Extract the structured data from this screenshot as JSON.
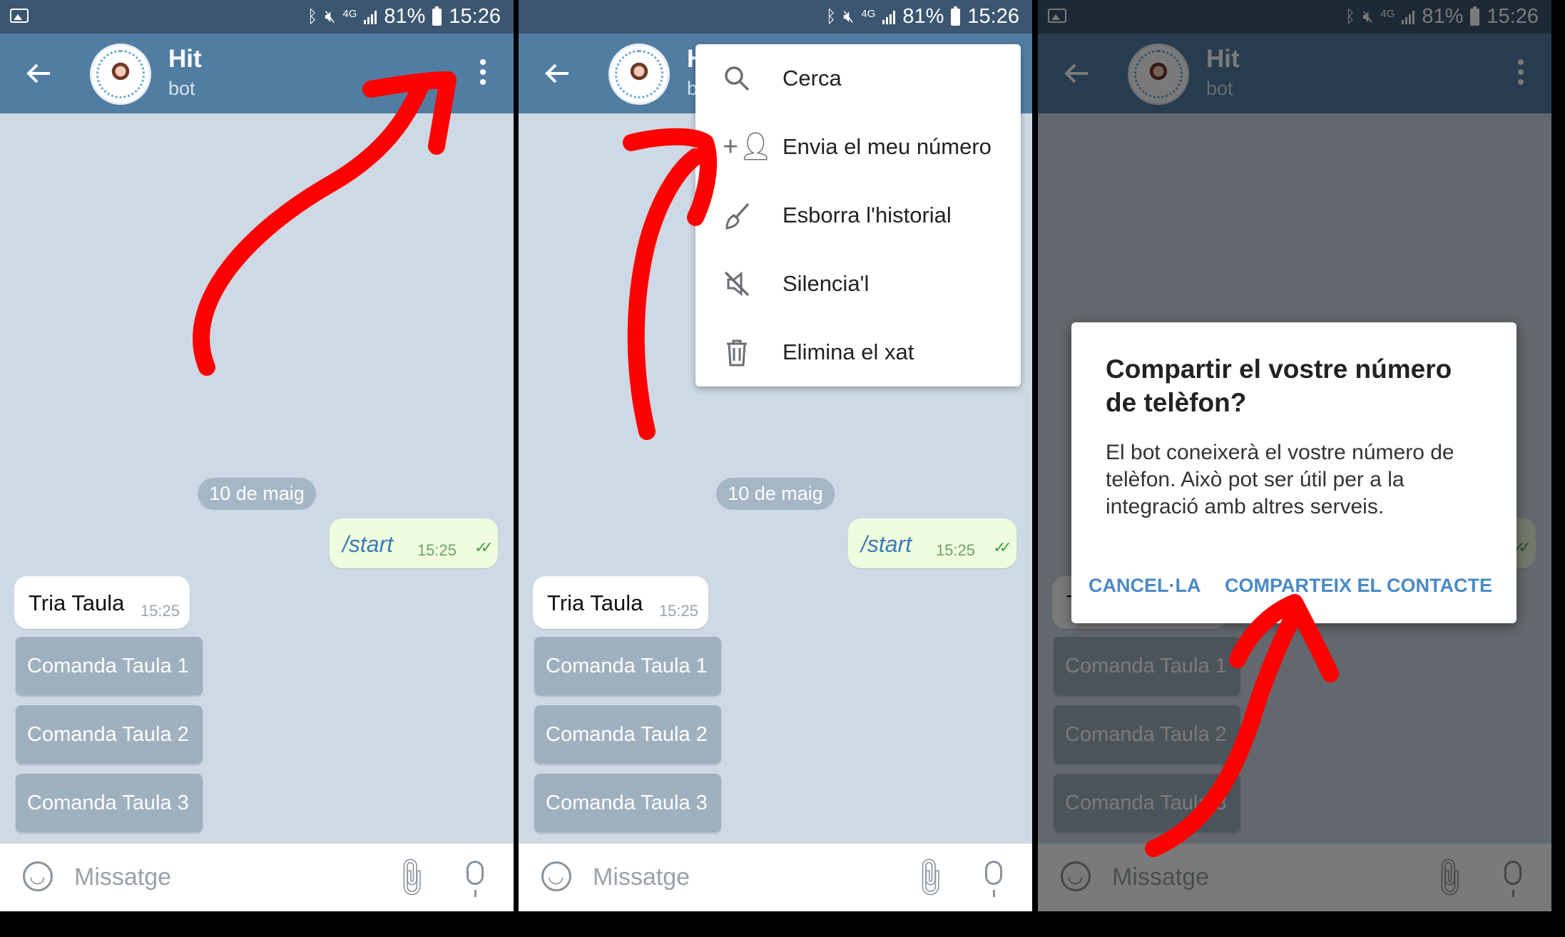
{
  "status_bar": {
    "battery": "81%",
    "time": "15:26",
    "network": "4G"
  },
  "header": {
    "title": "Hit",
    "subtitle": "bot"
  },
  "chat": {
    "date_chip": "10 de maig",
    "outgoing": {
      "text": "/start",
      "time": "15:25"
    },
    "incoming": {
      "text": "Tria Taula",
      "time": "15:25"
    },
    "keyboard_buttons": [
      "Comanda Taula 1",
      "Comanda Taula 2",
      "Comanda Taula 3"
    ]
  },
  "input": {
    "placeholder": "Missatge"
  },
  "menu": {
    "items": [
      {
        "label": "Cerca",
        "icon": "search-icon"
      },
      {
        "label": "Envia el meu número",
        "icon": "add-contact-icon"
      },
      {
        "label": "Esborra l'historial",
        "icon": "broom-icon"
      },
      {
        "label": "Silencia'l",
        "icon": "mute-icon"
      },
      {
        "label": "Elimina el xat",
        "icon": "trash-icon"
      }
    ]
  },
  "dialog": {
    "title": "Compartir el vostre número de telèfon?",
    "body": "El bot coneixerà el vostre número de telèfon. Això pot ser útil per a la integració amb altres serveis.",
    "cancel": "CANCEL·LA",
    "confirm": "COMPARTEIX EL CONTACTE"
  },
  "colors": {
    "header": "#527da3",
    "status_bar": "#3b5670",
    "annotation": "#ff0000",
    "link": "#4a8ac4"
  }
}
